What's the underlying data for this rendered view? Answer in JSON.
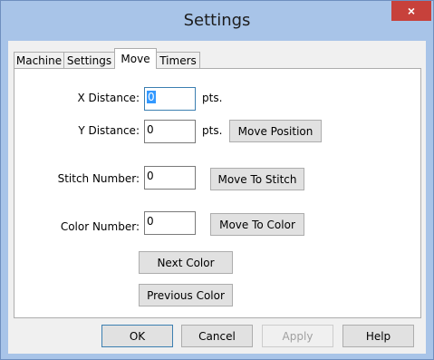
{
  "window": {
    "title": "Settings",
    "close_label": "×"
  },
  "tabs": [
    {
      "label": "Machine"
    },
    {
      "label": "Settings"
    },
    {
      "label": "Move",
      "active": true
    },
    {
      "label": "Timers"
    }
  ],
  "move": {
    "x_distance": {
      "label": "X Distance:",
      "value": "0",
      "unit": "pts."
    },
    "y_distance": {
      "label": "Y Distance:",
      "value": "0",
      "unit": "pts."
    },
    "move_position_label": "Move Position",
    "stitch_number": {
      "label": "Stitch Number:",
      "value": "0"
    },
    "move_to_stitch_label": "Move To Stitch",
    "color_number": {
      "label": "Color Number:",
      "value": "0"
    },
    "move_to_color_label": "Move To  Color",
    "next_color_label": "Next Color",
    "previous_color_label": "Previous Color"
  },
  "footer": {
    "ok_label": "OK",
    "cancel_label": "Cancel",
    "apply_label": "Apply",
    "help_label": "Help"
  }
}
